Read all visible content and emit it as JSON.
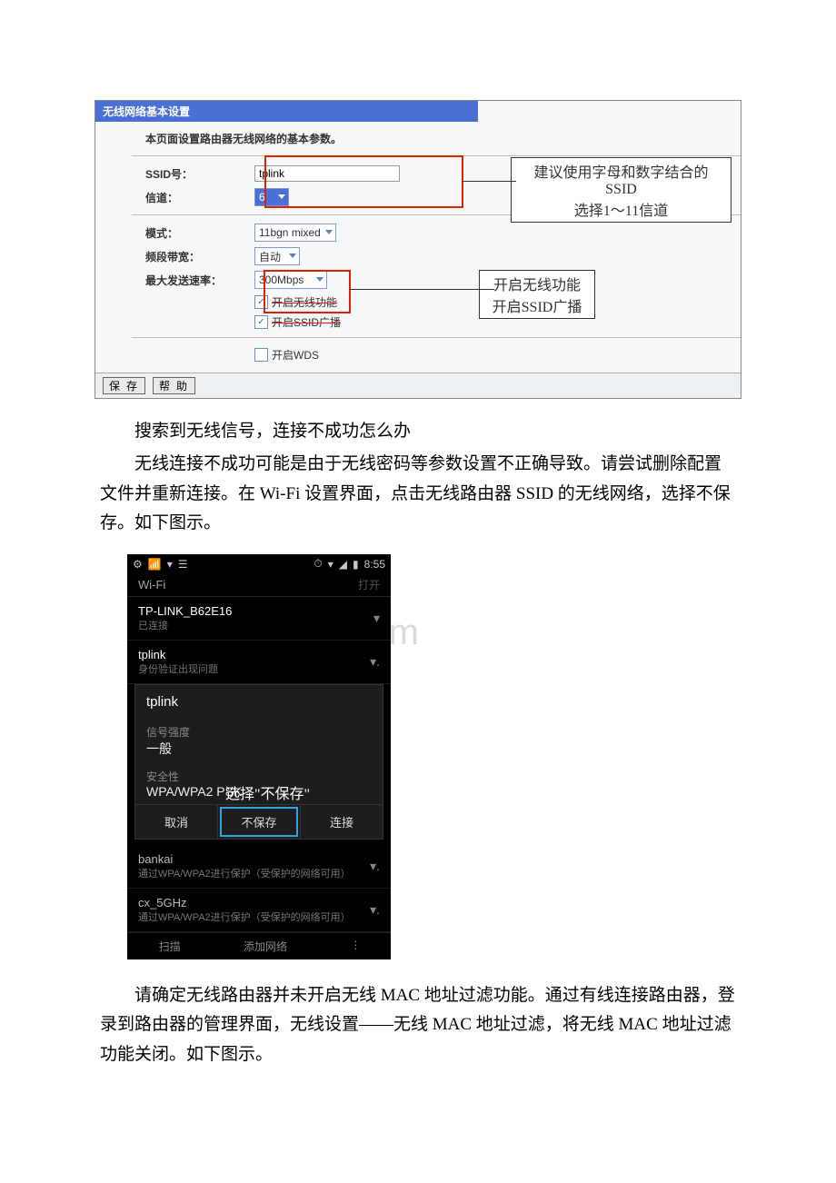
{
  "router": {
    "title": "无线网络基本设置",
    "desc": "本页面设置路由器无线网络的基本参数。",
    "labels": {
      "ssid": "SSID号：",
      "channel": "信道：",
      "mode": "模式：",
      "bandwidth": "频段带宽：",
      "maxrate": "最大发送速率："
    },
    "values": {
      "ssid": "tplink",
      "channel": "6",
      "mode": "11bgn mixed",
      "bandwidth": "自动",
      "maxrate": "300Mbps"
    },
    "checks": {
      "enable_wifi": "开启无线功能",
      "enable_ssid": "开启SSID广播",
      "enable_wds": "开启WDS"
    },
    "callout1_line1": "建议使用字母和数字结合的SSID",
    "callout1_line2": "选择1～11信道",
    "callout2_line1": "开启无线功能",
    "callout2_line2": "开启SSID广播",
    "btn_save": "保 存",
    "btn_help": "帮 助"
  },
  "article": {
    "p1": "搜索到无线信号，连接不成功怎么办",
    "p2": "无线连接不成功可能是由于无线密码等参数设置不正确导致。请尝试删除配置文件并重新连接。在 Wi-Fi 设置界面，点击无线路由器 SSID 的无线网络，选择不保存。如下图示。",
    "p3": "请确定无线路由器并未开启无线 MAC 地址过滤功能。通过有线连接路由器，登录到路由器的管理界面，无线设置——无线 MAC 地址过滤，将无线 MAC 地址过滤功能关闭。如下图示。"
  },
  "phone": {
    "time": "8:55",
    "header": "Wi-Fi",
    "switch": "打开",
    "net1_name": "TP-LINK_B62E16",
    "net1_sub": "已连接",
    "net2_name": "tplink",
    "net2_sub": "身份验证出现问题",
    "dlg_title": "tplink",
    "strength_lab": "信号强度",
    "strength_val": "一般",
    "security_lab": "安全性",
    "security_val": "WPA/WPA2 PSK",
    "btn_cancel": "取消",
    "btn_forget": "不保存",
    "btn_connect": "连接",
    "annotation": "选择\"不保存\"",
    "net3_name": "bankai",
    "net3_sub": "通过WPA/WPA2进行保护（受保护的网络可用）",
    "net4_name": "cx_5GHz",
    "net4_sub": "通过WPA/WPA2进行保护（受保护的网络可用）",
    "footer_scan": "扫描",
    "footer_add": "添加网络"
  },
  "watermark": "www.bdocx.com"
}
